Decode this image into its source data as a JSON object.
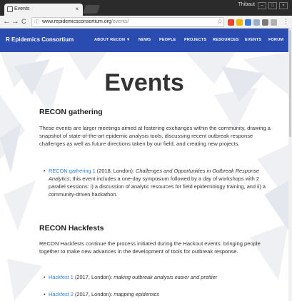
{
  "browser": {
    "tab_title": "Events",
    "tab_close": "×",
    "profile_name": "Thibaut",
    "window_buttons": [
      "–",
      "□",
      "×"
    ],
    "nav": {
      "back": "←",
      "forward": "→",
      "reload": "C"
    },
    "url_info": "ⓘ",
    "url_domain": "www.repidemicsconsortium.org",
    "url_path": "/events/",
    "star": "☆",
    "menu": "⋮",
    "extension_colors": [
      "#e8452c",
      "#f2b705",
      "#3b7de0",
      "#9bb0c8",
      "#7a7a7a",
      "#b0b0b0"
    ]
  },
  "site": {
    "brand": "R Epidemics Consortium",
    "nav": [
      "ABOUT RECON ▼",
      "NEWS",
      "PEOPLE",
      "PROJECTS",
      "RESOURCES",
      "EVENTS",
      "FORUM"
    ],
    "accent_color": "#2a4bb0"
  },
  "page": {
    "title": "Events",
    "sections": [
      {
        "heading": "RECON gathering",
        "intro": "These events are larger meetings aimed at fostering exchanges within the community, drawing a snapshot of state-of-the-art epidemic analysis tools, discussing recent outbreak response challenges as well as future directions taken by our field, and creating new projects.",
        "items": [
          {
            "link": "RECON gathering 1",
            "meta": " (2018, London): ",
            "title": "Challenges and Opportunities in Outbreak Response Analytics",
            "rest": "; this event includes a one-day symposium followed by a day of workshops with 2 parallel sessions: i) a discussion of analytic resources for field epidemiology training, and ii) a community-driven hackathon."
          }
        ]
      },
      {
        "heading": "RECON Hackfests",
        "intro": "RECON Hackfests continue the process initiated during the Hackout events: bringing people together to make new advances in the development of tools for outbreak response.",
        "items": [
          {
            "link": "Hackfest 1",
            "meta": " (2017, London): ",
            "title": "making outbreak analysis easier and prettier"
          },
          {
            "link": "Hackfest 2",
            "meta": " (2017, London): ",
            "title": "mapping epidemics"
          }
        ]
      }
    ]
  }
}
